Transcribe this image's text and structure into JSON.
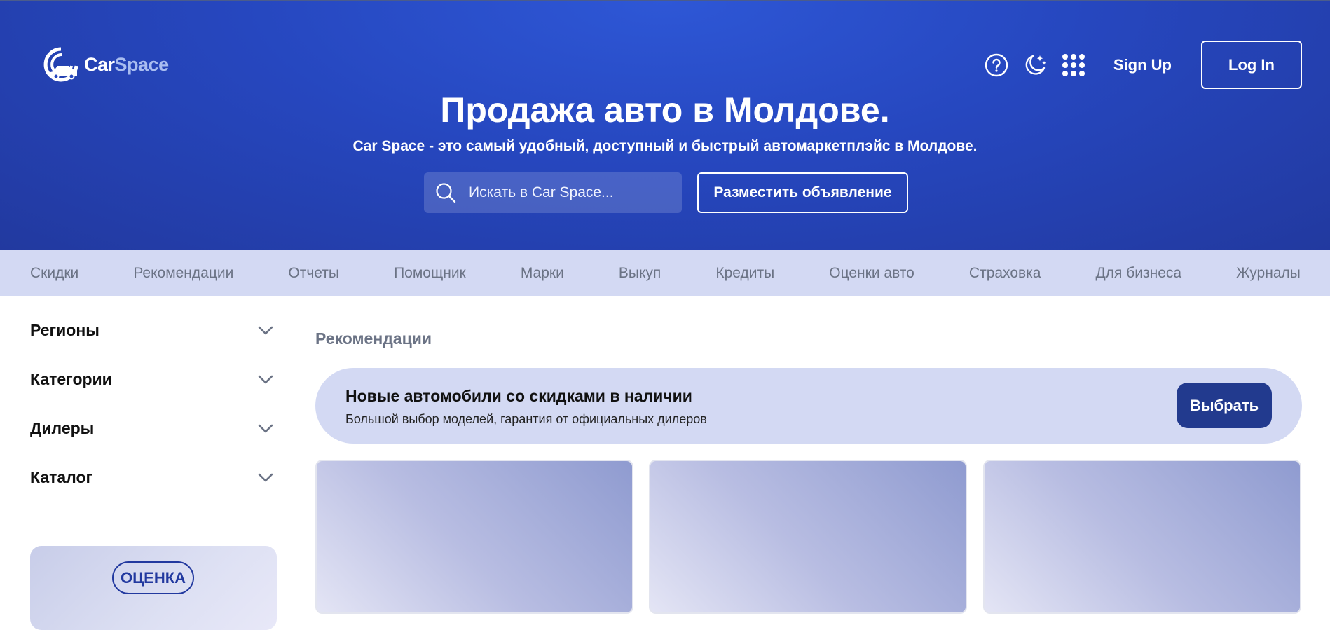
{
  "brand": {
    "logo_car": "Car",
    "logo_space": "Space",
    "accent_color": "#22399f",
    "hero_color": "#2647bf"
  },
  "header": {
    "help_icon": "help-circle-icon",
    "theme_icon": "moon-stars-icon",
    "apps_icon": "grid-dots-icon",
    "signup_label": "Sign Up",
    "login_label": "Log In"
  },
  "hero": {
    "title": "Продажа авто в Молдове.",
    "subtitle": "Car Space - это самый удобный, доступный и быстрый автомаркетплэйс в Молдове.",
    "search_placeholder": "Искать в Car Space...",
    "post_button": "Разместить объявление"
  },
  "nav": {
    "items": [
      {
        "label": "Скидки"
      },
      {
        "label": "Рекомендации"
      },
      {
        "label": "Отчеты"
      },
      {
        "label": "Помощник"
      },
      {
        "label": "Марки"
      },
      {
        "label": "Выкуп"
      },
      {
        "label": "Кредиты"
      },
      {
        "label": "Оценки авто"
      },
      {
        "label": "Страховка"
      },
      {
        "label": "Для бизнеса"
      },
      {
        "label": "Журналы"
      }
    ]
  },
  "sidebar": {
    "items": [
      {
        "label": "Регионы"
      },
      {
        "label": "Категории"
      },
      {
        "label": "Дилеры"
      },
      {
        "label": "Каталог"
      }
    ],
    "promo_badge": "ОЦЕНКА"
  },
  "main": {
    "section_title": "Рекомендации",
    "banner": {
      "title": "Новые автомобили со скидками в наличии",
      "subtitle": "Большой выбор моделей, гарантия от официальных дилеров",
      "button": "Выбрать"
    }
  }
}
